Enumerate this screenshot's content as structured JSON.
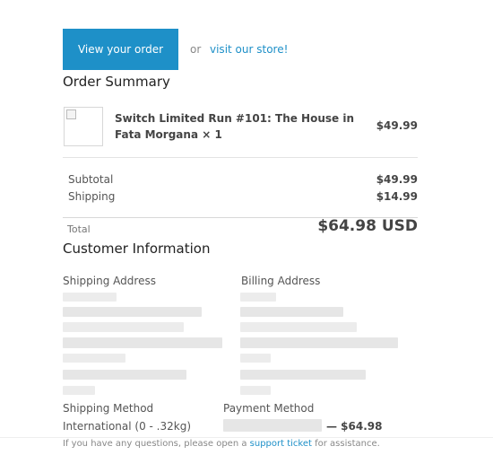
{
  "header": {
    "view_order_label": "View your order",
    "or_text": "or",
    "store_link": "visit our store!"
  },
  "order_summary": {
    "title": "Order Summary",
    "items": [
      {
        "name": "Switch Limited Run #101: The House in Fata Morgana × 1",
        "price": "$49.99"
      }
    ],
    "subtotal_label": "Subtotal",
    "subtotal": "$49.99",
    "shipping_label": "Shipping",
    "shipping": "$14.99",
    "total_label": "Total",
    "total": "$64.98 USD"
  },
  "customer": {
    "title": "Customer Information",
    "shipping_address_label": "Shipping Address",
    "billing_address_label": "Billing Address",
    "shipping_method_label": "Shipping Method",
    "shipping_method": "International (0 - .32kg)",
    "payment_method_label": "Payment Method",
    "payment_amount": "— $64.98"
  },
  "footer": {
    "prefix": "If you have any questions, please open a",
    "link": "support ticket",
    "suffix": "for assistance."
  }
}
